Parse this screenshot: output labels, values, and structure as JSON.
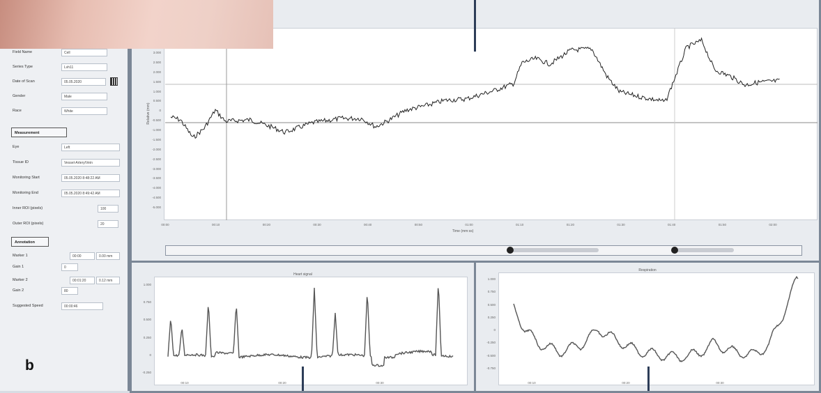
{
  "left_panel": {
    "fields": [
      {
        "label": "Field Name",
        "value": "Cell"
      },
      {
        "label": "Series Type",
        "value": "Lvh11"
      },
      {
        "label": "Date of Scan",
        "value": "05.05.2020"
      },
      {
        "label": "Gender",
        "value": "Male"
      },
      {
        "label": "Race",
        "value": "White"
      }
    ],
    "section_measurement": "Measurement",
    "measurement_fields": [
      {
        "label": "Eye",
        "value": "Left"
      },
      {
        "label": "Tissue ID",
        "value": "Vessel-Artery/Vein"
      },
      {
        "label": "Monitoring Start",
        "value": "05.05.2020 8:48:22 AM"
      },
      {
        "label": "Monitoring End",
        "value": "05.05.2020 8:49:42 AM"
      },
      {
        "label": "Inner ROI (pixels)",
        "value": "100"
      },
      {
        "label": "Outer ROI (pixels)",
        "value": "20"
      }
    ],
    "section_annotation": "Annotation",
    "annotation_fields": [
      {
        "label": "Marker 1",
        "value_a": "00:00",
        "value_b": "0.00 mm"
      },
      {
        "label": "Gain 1",
        "value": "0"
      },
      {
        "label": "Marker 2",
        "value_a": "00:01:20",
        "value_b": "0.12 mm"
      },
      {
        "label": "Gain 2",
        "value": "80"
      },
      {
        "label": "Suggested Speed",
        "value": "00:00:46"
      }
    ],
    "panel_letter": "b"
  },
  "main_plot": {
    "ylabel": "Relative (mm)",
    "xlabel": "Time (mm:ss)",
    "y_ticks": [
      "3.000",
      "2.500",
      "2.000",
      "1.500",
      "1.000",
      "0.500",
      "0",
      "-0.500",
      "-1.000",
      "-1.500",
      "-2.000",
      "-2.500",
      "-3.000",
      "-3.500",
      "-4.000",
      "-4.500",
      "-5.000"
    ],
    "x_ticks": [
      "00:00",
      "00:10",
      "00:20",
      "00:30",
      "00:40",
      "00:50",
      "01:00",
      "01:10",
      "01:20",
      "01:30",
      "01:40",
      "01:50",
      "02:00"
    ]
  },
  "bottom_left_plot": {
    "title": "Heart signal",
    "y_ticks": [
      "1.000",
      "0.750",
      "0.500",
      "0.250",
      "0",
      "-0.250"
    ],
    "x_ticks": [
      "00:10",
      "00:20",
      "00:30"
    ]
  },
  "bottom_right_plot": {
    "title": "Respiration",
    "y_ticks": [
      "1.000",
      "0.750",
      "0.500",
      "0.250",
      "0",
      "-0.250",
      "-0.500",
      "-0.750"
    ],
    "x_ticks": [
      "00:10",
      "00:20",
      "00:30"
    ]
  },
  "colors": {
    "frame": "#7b8796",
    "trace": "#222222",
    "marker": "#2d3d58"
  }
}
